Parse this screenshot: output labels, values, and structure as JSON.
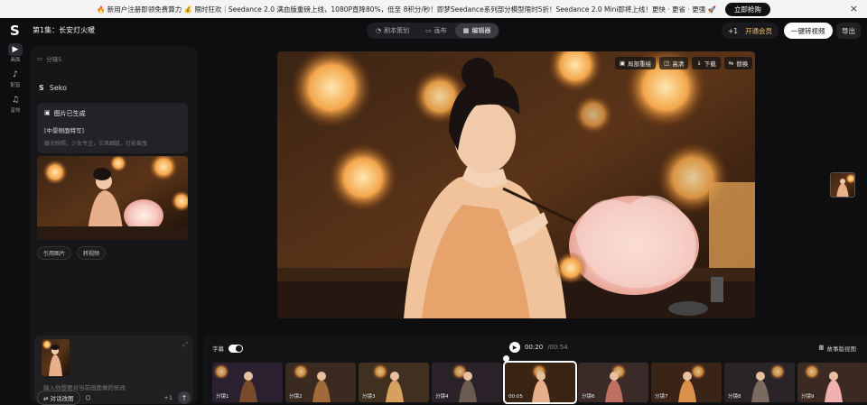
{
  "banner": {
    "text": "🔥 新用户注册即领免费算力 💰 限时狂欢｜Seedance 2.0 满血版重磅上线，1080P直降80%，低至 8积分/秒！即梦Seedance系列部分模型限时5折！Seedance 2.0 Mini即将上线！更快 · 更省 · 更强 🚀",
    "cta": "立即抢购",
    "close_icon": "×"
  },
  "header": {
    "logo": "S",
    "episode_title": "第1集：长安灯火暖",
    "tabs": [
      {
        "label": "剧本策划",
        "icon": "◔",
        "active": false
      },
      {
        "label": "画布",
        "icon": "▭",
        "active": false
      },
      {
        "label": "编辑器",
        "icon": "▦",
        "active": true
      }
    ],
    "credits": "+1",
    "vip_label": "开通会员",
    "generate_label": "一键转视频",
    "exit_label": "导出"
  },
  "rail": [
    {
      "icon": "▶",
      "label": "画面",
      "active": true
    },
    {
      "icon": "♪",
      "label": "配音",
      "active": false
    },
    {
      "icon": "♫",
      "label": "音效",
      "active": false
    }
  ],
  "chat": {
    "segment_label": "分镜5",
    "agent_name": "Seko",
    "card": {
      "title": "图片已生成",
      "subtitle": "[中景侧面特写]",
      "desc": "暖光映照，少女专注，古风细腻，灯影摇曳"
    },
    "pills": [
      "引用图片",
      "转视频"
    ],
    "input_placeholder": "输入你想要对当前画面做的修改",
    "mode_label": "对话改图",
    "count": "+1"
  },
  "preview": {
    "tools": [
      "局部重绘",
      "高清",
      "下载",
      "替换"
    ]
  },
  "timeline": {
    "subtitle_label": "字幕",
    "time_current": "00:20",
    "time_total": "00:54",
    "storyboard_label": "故事版视图",
    "clips": [
      {
        "label": "分镜1",
        "active": false
      },
      {
        "label": "分镜2",
        "active": false
      },
      {
        "label": "分镜3",
        "active": false
      },
      {
        "label": "分镜4",
        "active": false
      },
      {
        "label": "00:05",
        "active": true
      },
      {
        "label": "分镜6",
        "active": false
      },
      {
        "label": "分镜7",
        "active": false
      },
      {
        "label": "分镜8",
        "active": false
      },
      {
        "label": "分镜9",
        "active": false
      }
    ]
  }
}
